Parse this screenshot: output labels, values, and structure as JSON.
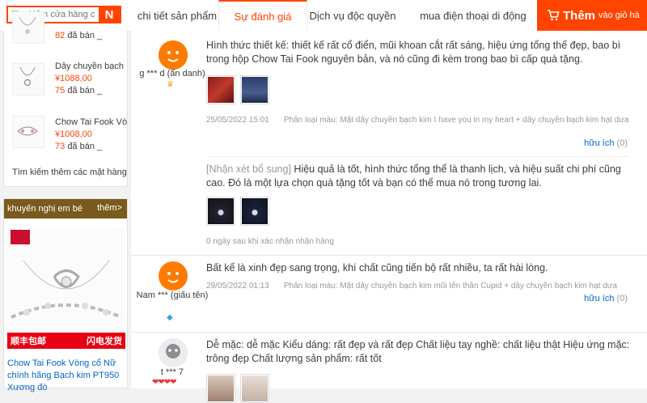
{
  "search": {
    "placeholder": "Tìm kiếm cửa hàng của",
    "button": "N"
  },
  "tabs": [
    {
      "label": "chi tiết sản phẩm"
    },
    {
      "label": "Sự đánh giá"
    },
    {
      "label": "Dịch vụ độc quyền"
    },
    {
      "label": "mua điện thoại di động"
    }
  ],
  "addcart": {
    "icon": "cart-icon",
    "big": "Thêm",
    "small": "vào giỏ hà"
  },
  "sidebar": {
    "products": [
      {
        "name": "",
        "price": "",
        "sold_count": "82",
        "sold_suffix": "đã bán _"
      },
      {
        "name": "Dây chuyền bạch",
        "price": "¥1088,00",
        "sold_count": "75",
        "sold_suffix": "đã bán _"
      },
      {
        "name": "Chow Tai Fook Vò",
        "price": "¥1008,00",
        "sold_count": "73",
        "sold_suffix": "đã bán _"
      }
    ],
    "find_more": "Tìm kiếm thêm các mặt hàng",
    "rec_title": "khuyến nghị em bé",
    "rec_more": "thêm>",
    "rec_banner_left": "顺丰包邮",
    "rec_banner_right": "闪电发货",
    "rec_product": "Chow Tai Fook Vòng cổ Nữ chính hãng Bạch kim PT950 Xương đò"
  },
  "reviews": [
    {
      "user": "g *** d (ẩn danh)",
      "text": "Hình thức thiết kế: thiết kế rất cổ điển, mũi khoan cắt rất sáng, hiệu ứng tổng thể đẹp, bao bì trong hộp Chow Tai Fook nguyên bản, và nó cũng đi kèm trong bao bì cấp quà tặng.",
      "date": "25/05/2022 15:01",
      "sku": "Phân loại màu: Mặt dây chuyền bạch kim I have you in my heart + dây chuyền bạch kim hạt dưa",
      "useful": "hữu ích",
      "useful_count": "(0)",
      "followup_label": "[Nhận xét bổ sung]",
      "followup_text": " Hiệu quả là tốt, hình thức tổng thể là thanh lịch, và hiệu suất chi phí cũng cao. Đó là một lựa chọn quà tặng tốt và bạn có thể mua nó trong tương lai.",
      "followup_time": "0 ngày sau khi xác nhận nhận hàng"
    },
    {
      "user": "Nam *** (giấu tên)",
      "text": "Bất kể là xinh đẹp sang trọng, khí chất cũng tiến bộ rất nhiều, ta rất hài lòng.",
      "date": "29/05/2022 01:13",
      "sku": "Phân loại màu: Mặt dây chuyền bạch kim mũi tên thần Cupid + dây chuyền bạch kim hạt dưa",
      "useful": "hữu ích",
      "useful_count": "(0)"
    },
    {
      "user": "t *** 7",
      "text": "Dễ mặc: dễ mặc Kiểu dáng: rất đẹp và rất đẹp Chất liệu tay nghề: chất liệu thật Hiệu ứng mặc: trông đẹp Chất lượng sản phẩm: rất tốt"
    }
  ],
  "colors": {
    "accent": "#ff4400",
    "link": "#0066cc",
    "rec_header": "#7a5a1d"
  }
}
